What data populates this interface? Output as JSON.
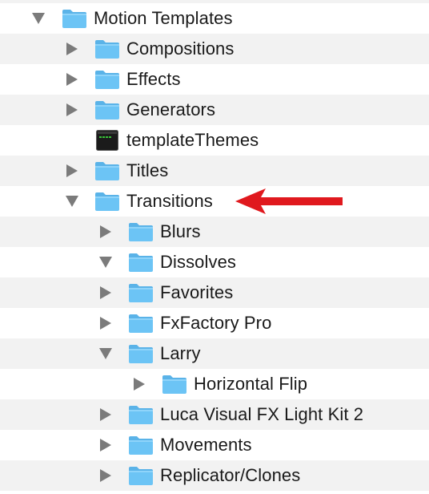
{
  "tree": {
    "items": [
      {
        "label": "Motion Templates",
        "expanded": true,
        "kind": "folder"
      },
      {
        "label": "Compositions",
        "expanded": false,
        "kind": "folder"
      },
      {
        "label": "Effects",
        "expanded": false,
        "kind": "folder"
      },
      {
        "label": "Generators",
        "expanded": false,
        "kind": "folder"
      },
      {
        "label": "templateThemes",
        "kind": "file"
      },
      {
        "label": "Titles",
        "expanded": false,
        "kind": "folder"
      },
      {
        "label": "Transitions",
        "expanded": true,
        "kind": "folder"
      },
      {
        "label": "Blurs",
        "expanded": false,
        "kind": "folder"
      },
      {
        "label": "Dissolves",
        "expanded": true,
        "kind": "folder"
      },
      {
        "label": "Favorites",
        "expanded": false,
        "kind": "folder"
      },
      {
        "label": "FxFactory Pro",
        "expanded": false,
        "kind": "folder"
      },
      {
        "label": "Larry",
        "expanded": true,
        "kind": "folder"
      },
      {
        "label": "Horizontal Flip",
        "expanded": false,
        "kind": "folder"
      },
      {
        "label": "Luca Visual FX Light Kit 2",
        "expanded": false,
        "kind": "folder"
      },
      {
        "label": "Movements",
        "expanded": false,
        "kind": "folder"
      },
      {
        "label": "Replicator/Clones",
        "expanded": false,
        "kind": "folder"
      }
    ]
  },
  "annotation": {
    "pointer": "red-arrow-icon",
    "color": "#e0191e"
  },
  "colors": {
    "folder_body": "#6cc4f5",
    "folder_tab": "#5ab3e8",
    "disclosure_triangle": "#7b7b7b",
    "alt_row": "#f2f2f2"
  }
}
